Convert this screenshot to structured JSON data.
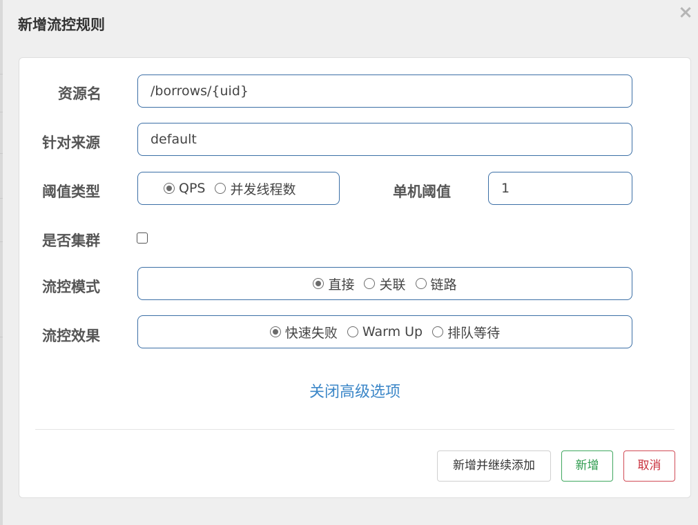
{
  "modal": {
    "title": "新增流控规则",
    "close_label": "×"
  },
  "form": {
    "resource": {
      "label": "资源名",
      "value": "/borrows/{uid}"
    },
    "source": {
      "label": "针对来源",
      "value": "default"
    },
    "threshold_type": {
      "label": "阈值类型",
      "options": [
        {
          "label": "QPS",
          "checked": true
        },
        {
          "label": "并发线程数",
          "checked": false
        }
      ]
    },
    "single_threshold": {
      "label": "单机阈值",
      "value": "1"
    },
    "cluster": {
      "label": "是否集群",
      "checked": false
    },
    "flow_mode": {
      "label": "流控模式",
      "options": [
        {
          "label": "直接",
          "checked": true
        },
        {
          "label": "关联",
          "checked": false
        },
        {
          "label": "链路",
          "checked": false
        }
      ]
    },
    "flow_effect": {
      "label": "流控效果",
      "options": [
        {
          "label": "快速失败",
          "checked": true
        },
        {
          "label": "Warm Up",
          "checked": false
        },
        {
          "label": "排队等待",
          "checked": false
        }
      ]
    },
    "advanced_toggle": "关闭高级选项"
  },
  "footer": {
    "add_continue": "新增并继续添加",
    "add": "新增",
    "cancel": "取消"
  },
  "colors": {
    "accent": "#3a6ea5",
    "link": "#3c87c8",
    "success": "#2e9b4e",
    "danger": "#c9303d"
  }
}
